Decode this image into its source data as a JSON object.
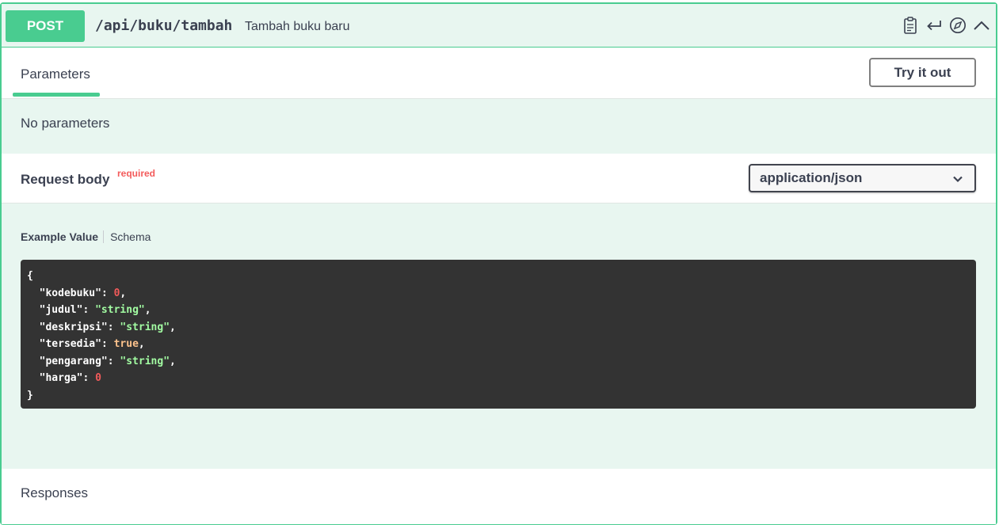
{
  "operation": {
    "method": "POST",
    "path": "/api/buku/tambah",
    "summary": "Tambah buku baru",
    "icons": [
      "clipboard-icon",
      "return-arrow-icon",
      "compass-icon",
      "chevron-up-icon"
    ]
  },
  "tabs": {
    "parameters_label": "Parameters",
    "try_label": "Try it out"
  },
  "parameters": {
    "empty_text": "No parameters"
  },
  "request_body": {
    "title": "Request body",
    "required_label": "required",
    "content_type": "application/json"
  },
  "example": {
    "active_tab": "Example Value",
    "other_tab": "Schema",
    "open_brace": "{",
    "close_brace": "}",
    "fields": [
      {
        "key": "\"kodebuku\"",
        "value": "0",
        "type": "number",
        "comma": ","
      },
      {
        "key": "\"judul\"",
        "value": "\"string\"",
        "type": "string",
        "comma": ","
      },
      {
        "key": "\"deskripsi\"",
        "value": "\"string\"",
        "type": "string",
        "comma": ","
      },
      {
        "key": "\"tersedia\"",
        "value": "true",
        "type": "boolean",
        "comma": ","
      },
      {
        "key": "\"pengarang\"",
        "value": "\"string\"",
        "type": "string",
        "comma": ","
      },
      {
        "key": "\"harga\"",
        "value": "0",
        "type": "number",
        "comma": ""
      }
    ]
  },
  "responses": {
    "title": "Responses"
  },
  "colors": {
    "post_green": "#49cc90",
    "panel_bg": "#e8f6f0",
    "code_bg": "#333333",
    "required_red": "#f35b5b"
  }
}
